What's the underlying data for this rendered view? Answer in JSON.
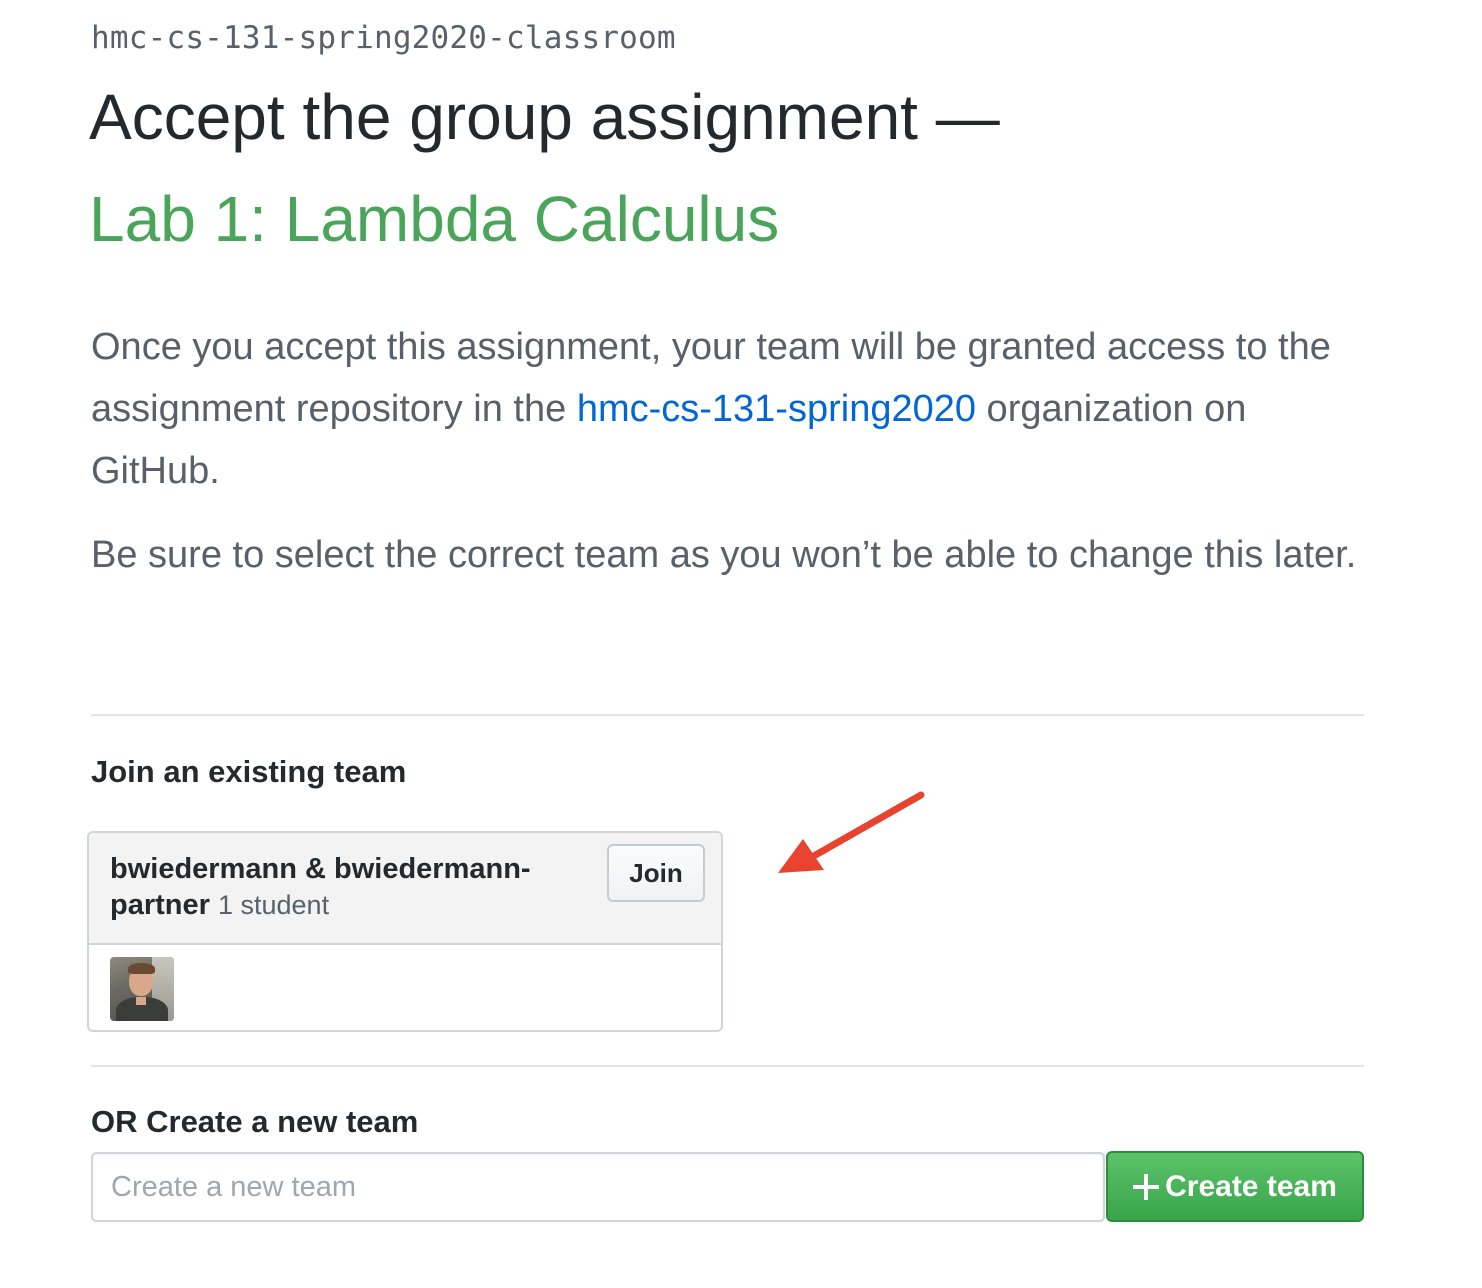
{
  "classroom": {
    "name": "hmc-cs-131-spring2020-classroom"
  },
  "header": {
    "title": "Accept the group assignment —",
    "assignment_title": "Lab 1: Lambda Calculus"
  },
  "intro": {
    "text_before_link": "Once you accept this assignment, your team will be granted access to the assignment repository in the ",
    "org_link_text": "hmc-cs-131-spring2020",
    "text_after_link": " organization on GitHub.",
    "warning": "Be sure to select the correct team as you won’t be able to change this later."
  },
  "join_section": {
    "heading": "Join an existing team",
    "teams": [
      {
        "name": "bwiedermann & bwiedermann-partner",
        "member_count": "1 student",
        "join_label": "Join"
      }
    ]
  },
  "create_section": {
    "heading": "OR Create a new team",
    "input_placeholder": "Create a new team",
    "input_value": "",
    "button_label": "Create team"
  },
  "colors": {
    "assignment_title": "#4aa55a",
    "link": "#0366d6",
    "create_button": "#3ea84f",
    "annotation_arrow": "#e8432f"
  },
  "icons": {
    "create_button_icon": "plus-icon",
    "annotation": "arrow-icon",
    "member_avatar": "avatar"
  }
}
